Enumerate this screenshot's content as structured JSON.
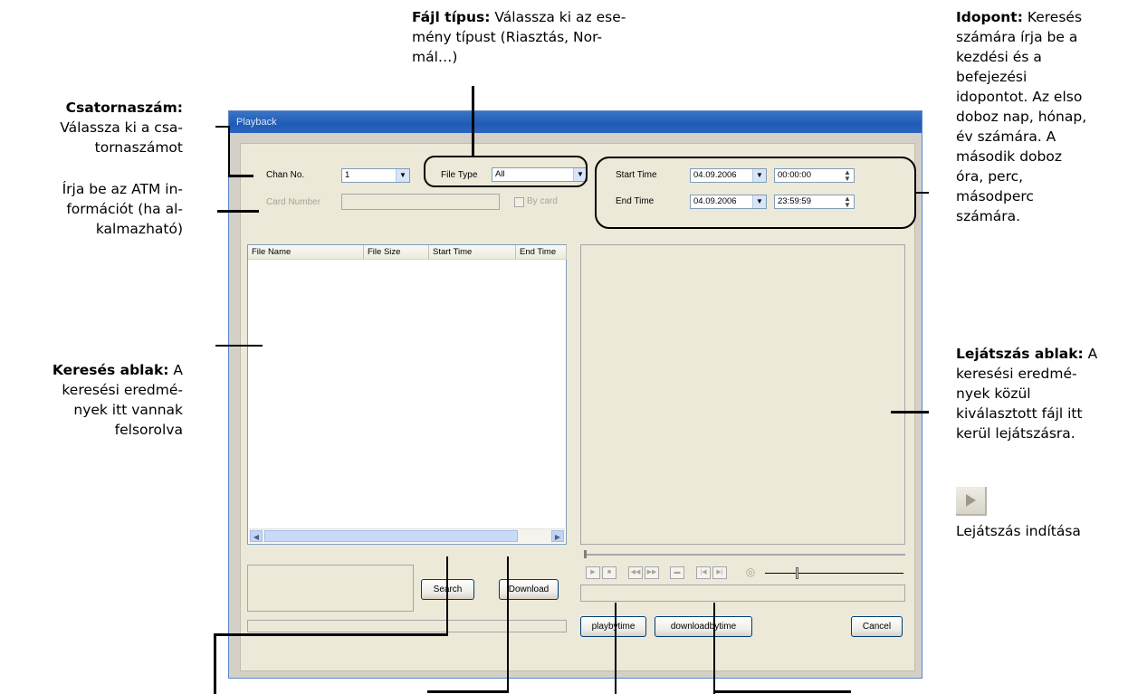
{
  "annotations": {
    "file_type": {
      "title": "Fájl típus:",
      "lines": [
        "Válassza ki az ese-",
        "mény típust (Riasztás, Nor-",
        "mál…)"
      ]
    },
    "time": {
      "title": "Idopont:",
      "lines": [
        "Keresés",
        "számára írja be a",
        "kezdési és a",
        "befejezési",
        "idopontot. Az elso",
        "doboz nap, hónap,",
        "év számára. A",
        "második doboz",
        "óra, perc,",
        "másodperc",
        "számára."
      ]
    },
    "channel": {
      "title": "Csatornaszám:",
      "lines": [
        "Válassza ki a csa-",
        "tornaszámot"
      ]
    },
    "atm": {
      "lines": [
        "Írja be az ATM in-",
        "formációt (ha al-",
        "kalmazható)"
      ]
    },
    "search_window": {
      "title": "Keresés ablak:",
      "lines": [
        "A",
        "keresési eredmé-",
        "nyek itt vannak",
        "felsorolva"
      ]
    },
    "playback_window": {
      "title": "Lejátszás ablak:",
      "lines": [
        "A",
        "keresési eredmé-",
        "nyek közül",
        "kiválasztott fájl itt",
        "kerül lejátszásra."
      ]
    },
    "play_start": {
      "label": "Lejátszás indítása"
    }
  },
  "dialog": {
    "title": "Playback",
    "chan_label": "Chan No.",
    "chan_value": "1",
    "file_type_label": "File Type",
    "file_type_value": "All",
    "start_time_label": "Start Time",
    "start_date": "04.09.2006",
    "start_clock": "00:00:00",
    "end_time_label": "End Time",
    "end_date": "04.09.2006",
    "end_clock": "23:59:59",
    "card_number_label": "Card Number",
    "by_card_label": "By card",
    "columns": [
      "File Name",
      "File Size",
      "Start Time",
      "End Time"
    ],
    "search_button": "Search",
    "download_button": "Download",
    "playbytime_button": "playbytime",
    "downloadbytime_button": "downloadbytime",
    "cancel_button": "Cancel"
  }
}
